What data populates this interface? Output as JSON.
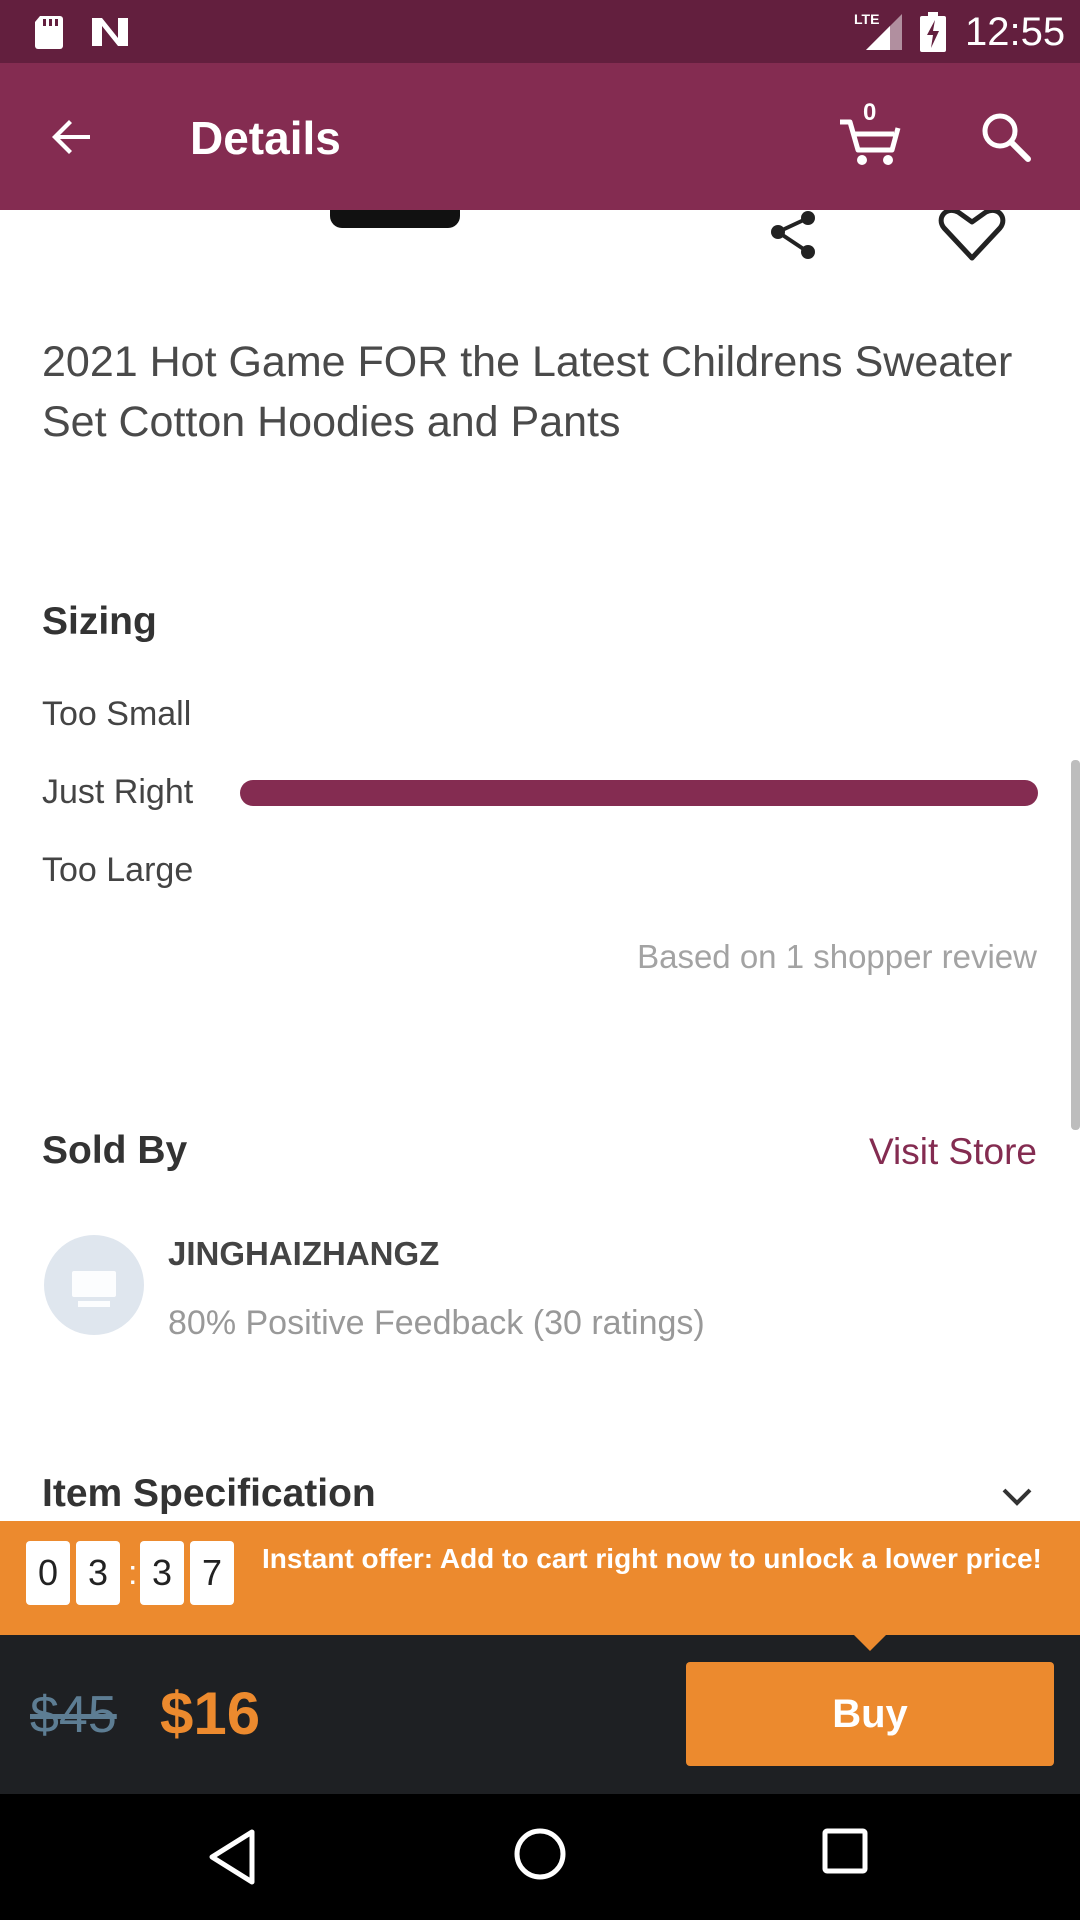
{
  "status_bar": {
    "network": "LTE",
    "time": "12:55",
    "icons": [
      "sd-card-icon",
      "n-icon",
      "signal-icon",
      "battery-charging-icon"
    ]
  },
  "app_bar": {
    "title": "Details",
    "cart_count": "0",
    "icons": [
      "back-arrow-icon",
      "cart-icon",
      "search-icon"
    ]
  },
  "product": {
    "title": "2021 Hot Game FOR the Latest Childrens Sweater Set Cotton Hoodies and Pants",
    "icons": [
      "share-icon",
      "heart-icon"
    ]
  },
  "sizing": {
    "heading": "Sizing",
    "rows": [
      {
        "label": "Too Small",
        "fraction": 0
      },
      {
        "label": "Just Right",
        "fraction": 1
      },
      {
        "label": "Too Large",
        "fraction": 0
      }
    ],
    "note": "Based on 1 shopper review",
    "bar_color": "#842c51"
  },
  "seller": {
    "heading": "Sold By",
    "visit_store": "Visit Store",
    "name": "JINGHAIZHANGZ",
    "feedback": "80% Positive Feedback (30 ratings)"
  },
  "item_spec": {
    "heading": "Item Specification",
    "icon": "chevron-down-icon"
  },
  "offer": {
    "digits": [
      "0",
      "3",
      "3",
      "7"
    ],
    "separator": ":",
    "text": "Instant offer: Add to cart right now to unlock a lower price!",
    "color": "#ec8a2e"
  },
  "buy_bar": {
    "old_price": "$45",
    "new_price": "$16",
    "buy_label": "Buy"
  },
  "nav_bar": {
    "icons": [
      "nav-back-icon",
      "nav-home-icon",
      "nav-recents-icon"
    ]
  },
  "colors": {
    "status_bar": "#631f3e",
    "app_bar": "#842c51",
    "accent": "#ec8a2e",
    "buy_bar": "#1e2023"
  }
}
